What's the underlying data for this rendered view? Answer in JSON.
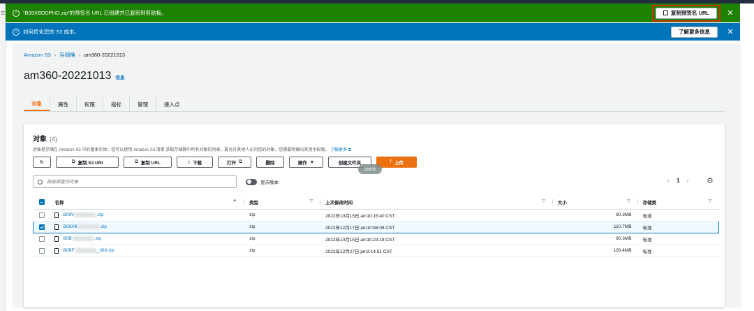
{
  "flash_success": {
    "message": "“B09XBDDPHD.zip”的预签名 URL 已创建并已复制到剪贴板。",
    "button_label": "复制预签名 URL"
  },
  "flash_info": {
    "message": "如何优化您的 S3 成本。",
    "button_label": "了解更多信息"
  },
  "breadcrumb": [
    "Amazon S3",
    "存储桶",
    "am360-20221013"
  ],
  "page_title": "am360-20221013",
  "info_link": "信息",
  "tabs": [
    "对象",
    "属性",
    "权限",
    "指标",
    "管理",
    "接入点"
  ],
  "objects": {
    "title": "对象",
    "count": "(4)",
    "description": "对象是存储在 Amazon S3 中的基本实体。您可以使用 Amazon S3 清单 获取存储桶中所有对象的列表。要允许其他人访问您的对象，您需要明确向其授予权限。",
    "learn_more": "了解更多",
    "toolbar": {
      "refresh": "",
      "copy_s3_uri": "复制 S3 URI",
      "copy_url": "复制 URL",
      "download": "下载",
      "open": "打开",
      "delete": "删除",
      "actions": "操作",
      "create_folder": "创建文件夹",
      "upload": "上传"
    },
    "badge": "266%",
    "search_placeholder": "按前缀查找对象",
    "show_versions": "显示版本",
    "page": "1",
    "columns": [
      "名称",
      "类型",
      "上次修改时间",
      "大小",
      "存储类"
    ],
    "rows": [
      {
        "name_prefix": "B09V",
        "name_suffix": ".zip",
        "type": "zip",
        "modified": "2022年10月15日 am10:15:40 CST",
        "size": "80.3MB",
        "storage": "标准",
        "checked": false
      },
      {
        "name_prefix": "B09XB",
        "name_suffix": ".zip",
        "type": "zip",
        "modified": "2022年12月17日 am10:58:08 CST",
        "size": "110.7MB",
        "storage": "标准",
        "checked": true
      },
      {
        "name_prefix": "B0B",
        "name_suffix": ".zip",
        "type": "zip",
        "modified": "2022年10月15日 am10:23:18 CST",
        "size": "80.3MB",
        "storage": "标准",
        "checked": false
      },
      {
        "name_prefix": "B0BF",
        "name_suffix": "_360.zip",
        "type": "zip",
        "modified": "2022年12月27日 pm3:14:51 CST",
        "size": "128.4MB",
        "storage": "标准",
        "checked": false
      }
    ]
  },
  "colors": {
    "success": "#1d8102",
    "info": "#0073bb",
    "accent": "#ec7211",
    "highlight_box": "#d13212"
  }
}
